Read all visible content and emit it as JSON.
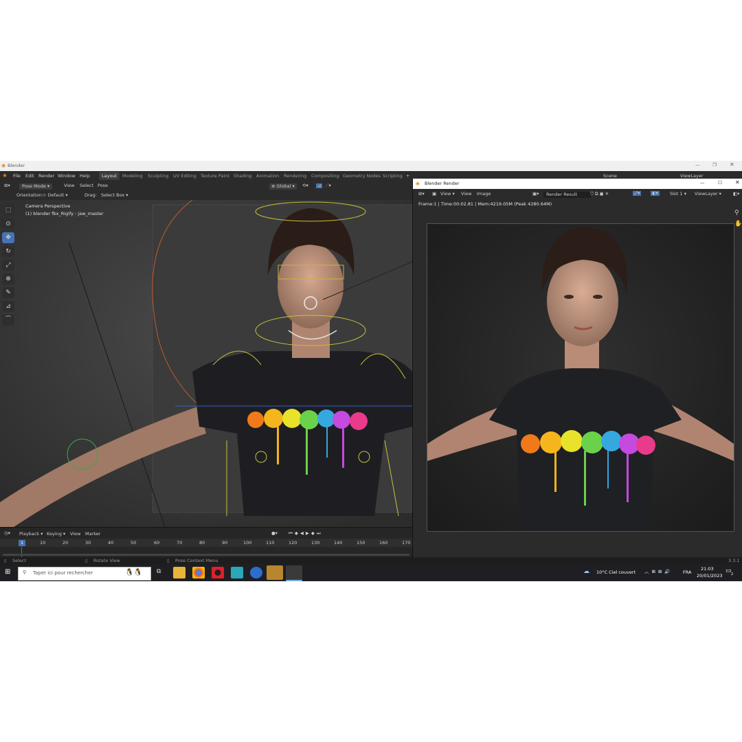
{
  "window": {
    "title": "Blender"
  },
  "menu": [
    "File",
    "Edit",
    "Render",
    "Window",
    "Help"
  ],
  "workspaces": [
    "Layout",
    "Modeling",
    "Sculpting",
    "UV Editing",
    "Texture Paint",
    "Shading",
    "Animation",
    "Rendering",
    "Compositing",
    "Geometry Nodes",
    "Scripting"
  ],
  "workspace_add": "+",
  "scene": {
    "label": "Scene",
    "viewlayer": "ViewLayer"
  },
  "viewport": {
    "mode": "Pose Mode",
    "menus": [
      "View",
      "Select",
      "Pose"
    ],
    "transform": "Global",
    "orientation_label": "Orientation:",
    "orientation_value": "Default",
    "drag_label": "Drag:",
    "drag_value": "Select Box",
    "overlay_line1": "Camera Perspective",
    "overlay_line2": "(1) blender fbx_Rigify : jaw_master"
  },
  "timeline": {
    "menus": [
      "Playback",
      "Keying",
      "View",
      "Marker"
    ],
    "current_frame": "1",
    "ticks": [
      "10",
      "20",
      "30",
      "40",
      "50",
      "60",
      "70",
      "80",
      "90",
      "100",
      "110",
      "120",
      "130",
      "140",
      "150",
      "160",
      "170"
    ]
  },
  "status": {
    "select": "Select",
    "rotate": "Rotate View",
    "context": "Pose Context Menu",
    "version": "3.3.1"
  },
  "render_window": {
    "title": "Blender Render",
    "menus": [
      "View",
      "View",
      "Image"
    ],
    "image_name": "Render Result",
    "slot": "Slot 1",
    "viewlayer": "ViewLayer",
    "info": "Frame:1 | Time:00:02.81 | Mem:4219.05M (Peak 4280.64M)"
  },
  "taskbar": {
    "search_placeholder": "Taper ici pour rechercher",
    "weather": "10°C  Ciel couvert",
    "lang": "FRA",
    "time": "21:03",
    "date": "20/01/2023",
    "notifications": "2"
  },
  "colors": {
    "accent": "#4772b3",
    "playhead": "#4772b3",
    "window_bg": "#2b2b2b"
  }
}
